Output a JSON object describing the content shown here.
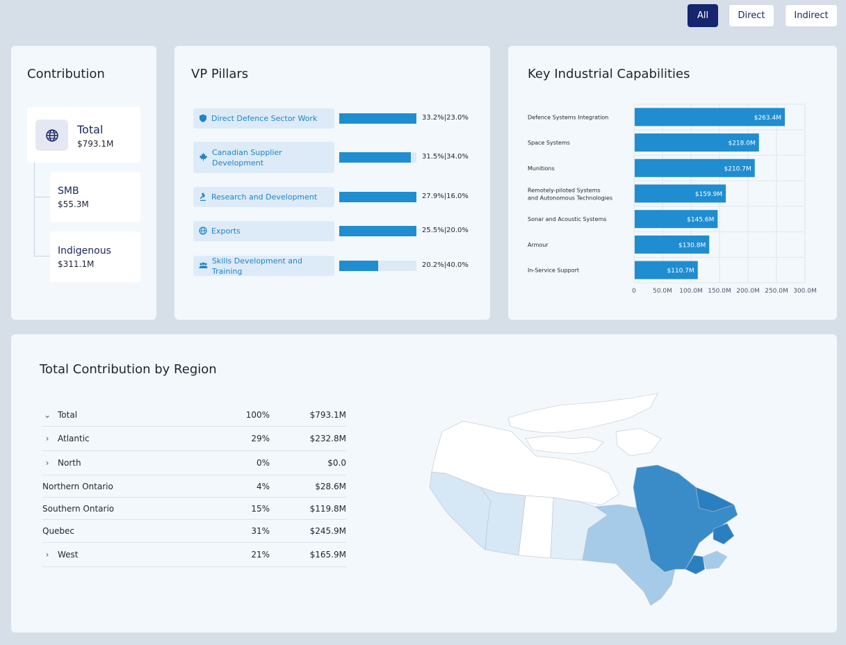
{
  "filters": {
    "all": "All",
    "direct": "Direct",
    "indirect": "Indirect",
    "active": "All"
  },
  "contribution": {
    "title": "Contribution",
    "total": {
      "label": "Total",
      "value": "$793.1M"
    },
    "smb": {
      "label": "SMB",
      "value": "$55.3M"
    },
    "indigenous": {
      "label": "Indigenous",
      "value": "$311.1M"
    }
  },
  "vp_pillars": {
    "title": "VP Pillars",
    "items": [
      {
        "label": "Direct Defence Sector Work",
        "icon": "shield-icon",
        "pct_text": "33.2%|23.0%",
        "fill": 1.0
      },
      {
        "label": "Canadian Supplier Development",
        "icon": "maple-leaf-icon",
        "pct_text": "31.5%|34.0%",
        "fill": 0.93
      },
      {
        "label": "Research and Development",
        "icon": "microscope-icon",
        "pct_text": "27.9%|16.0%",
        "fill": 1.0
      },
      {
        "label": "Exports",
        "icon": "globe-icon",
        "pct_text": "25.5%|20.0%",
        "fill": 1.0
      },
      {
        "label": "Skills Development and Training",
        "icon": "people-icon",
        "pct_text": "20.2%|40.0%",
        "fill": 0.5
      }
    ]
  },
  "key_capabilities": {
    "title": "Key Industrial Capabilities",
    "chart_data": {
      "type": "bar",
      "orientation": "horizontal",
      "categories": [
        "Defence Systems Integration",
        "Space Systems",
        "Munitions",
        "Remotely-piloted Systems and Autonomous Technologies",
        "Sonar and Acoustic Systems",
        "Armour",
        "In-Service Support"
      ],
      "values": [
        263.4,
        218.0,
        210.7,
        159.9,
        145.6,
        130.8,
        110.7
      ],
      "data_labels": [
        "$263.4M",
        "$218.0M",
        "$210.7M",
        "$159.9M",
        "$145.6M",
        "$130.8M",
        "$110.7M"
      ],
      "xlim": [
        0,
        300
      ],
      "xticks": [
        "0",
        "50.0M",
        "100.0M",
        "150.0M",
        "200.0M",
        "250.0M",
        "300.0M"
      ],
      "grid": true,
      "bar_color": "#1f8dd0"
    }
  },
  "region": {
    "title": "Total Contribution by Region",
    "rows": [
      {
        "name": "Total",
        "pct": "100%",
        "value": "$793.1M",
        "chevron": "down"
      },
      {
        "name": "Atlantic",
        "pct": "29%",
        "value": "$232.8M",
        "chevron": "right"
      },
      {
        "name": "North",
        "pct": "0%",
        "value": "$0.0",
        "chevron": "right"
      },
      {
        "name": "Northern Ontario",
        "pct": "4%",
        "value": "$28.6M",
        "chevron": "none"
      },
      {
        "name": "Southern Ontario",
        "pct": "15%",
        "value": "$119.8M",
        "chevron": "none"
      },
      {
        "name": "Quebec",
        "pct": "31%",
        "value": "$245.9M",
        "chevron": "none"
      },
      {
        "name": "West",
        "pct": "21%",
        "value": "$165.9M",
        "chevron": "right"
      }
    ],
    "map_colors": {
      "north": "#ffffff",
      "west": "#d6e7f5",
      "saskatchewan": "#ffffff",
      "manitoba": "#e2eef8",
      "ontario": "#a6cbe8",
      "quebec": "#3a8cc8",
      "atlantic": "#2a7fc0",
      "nova_scotia": "#a6cbe8"
    }
  }
}
